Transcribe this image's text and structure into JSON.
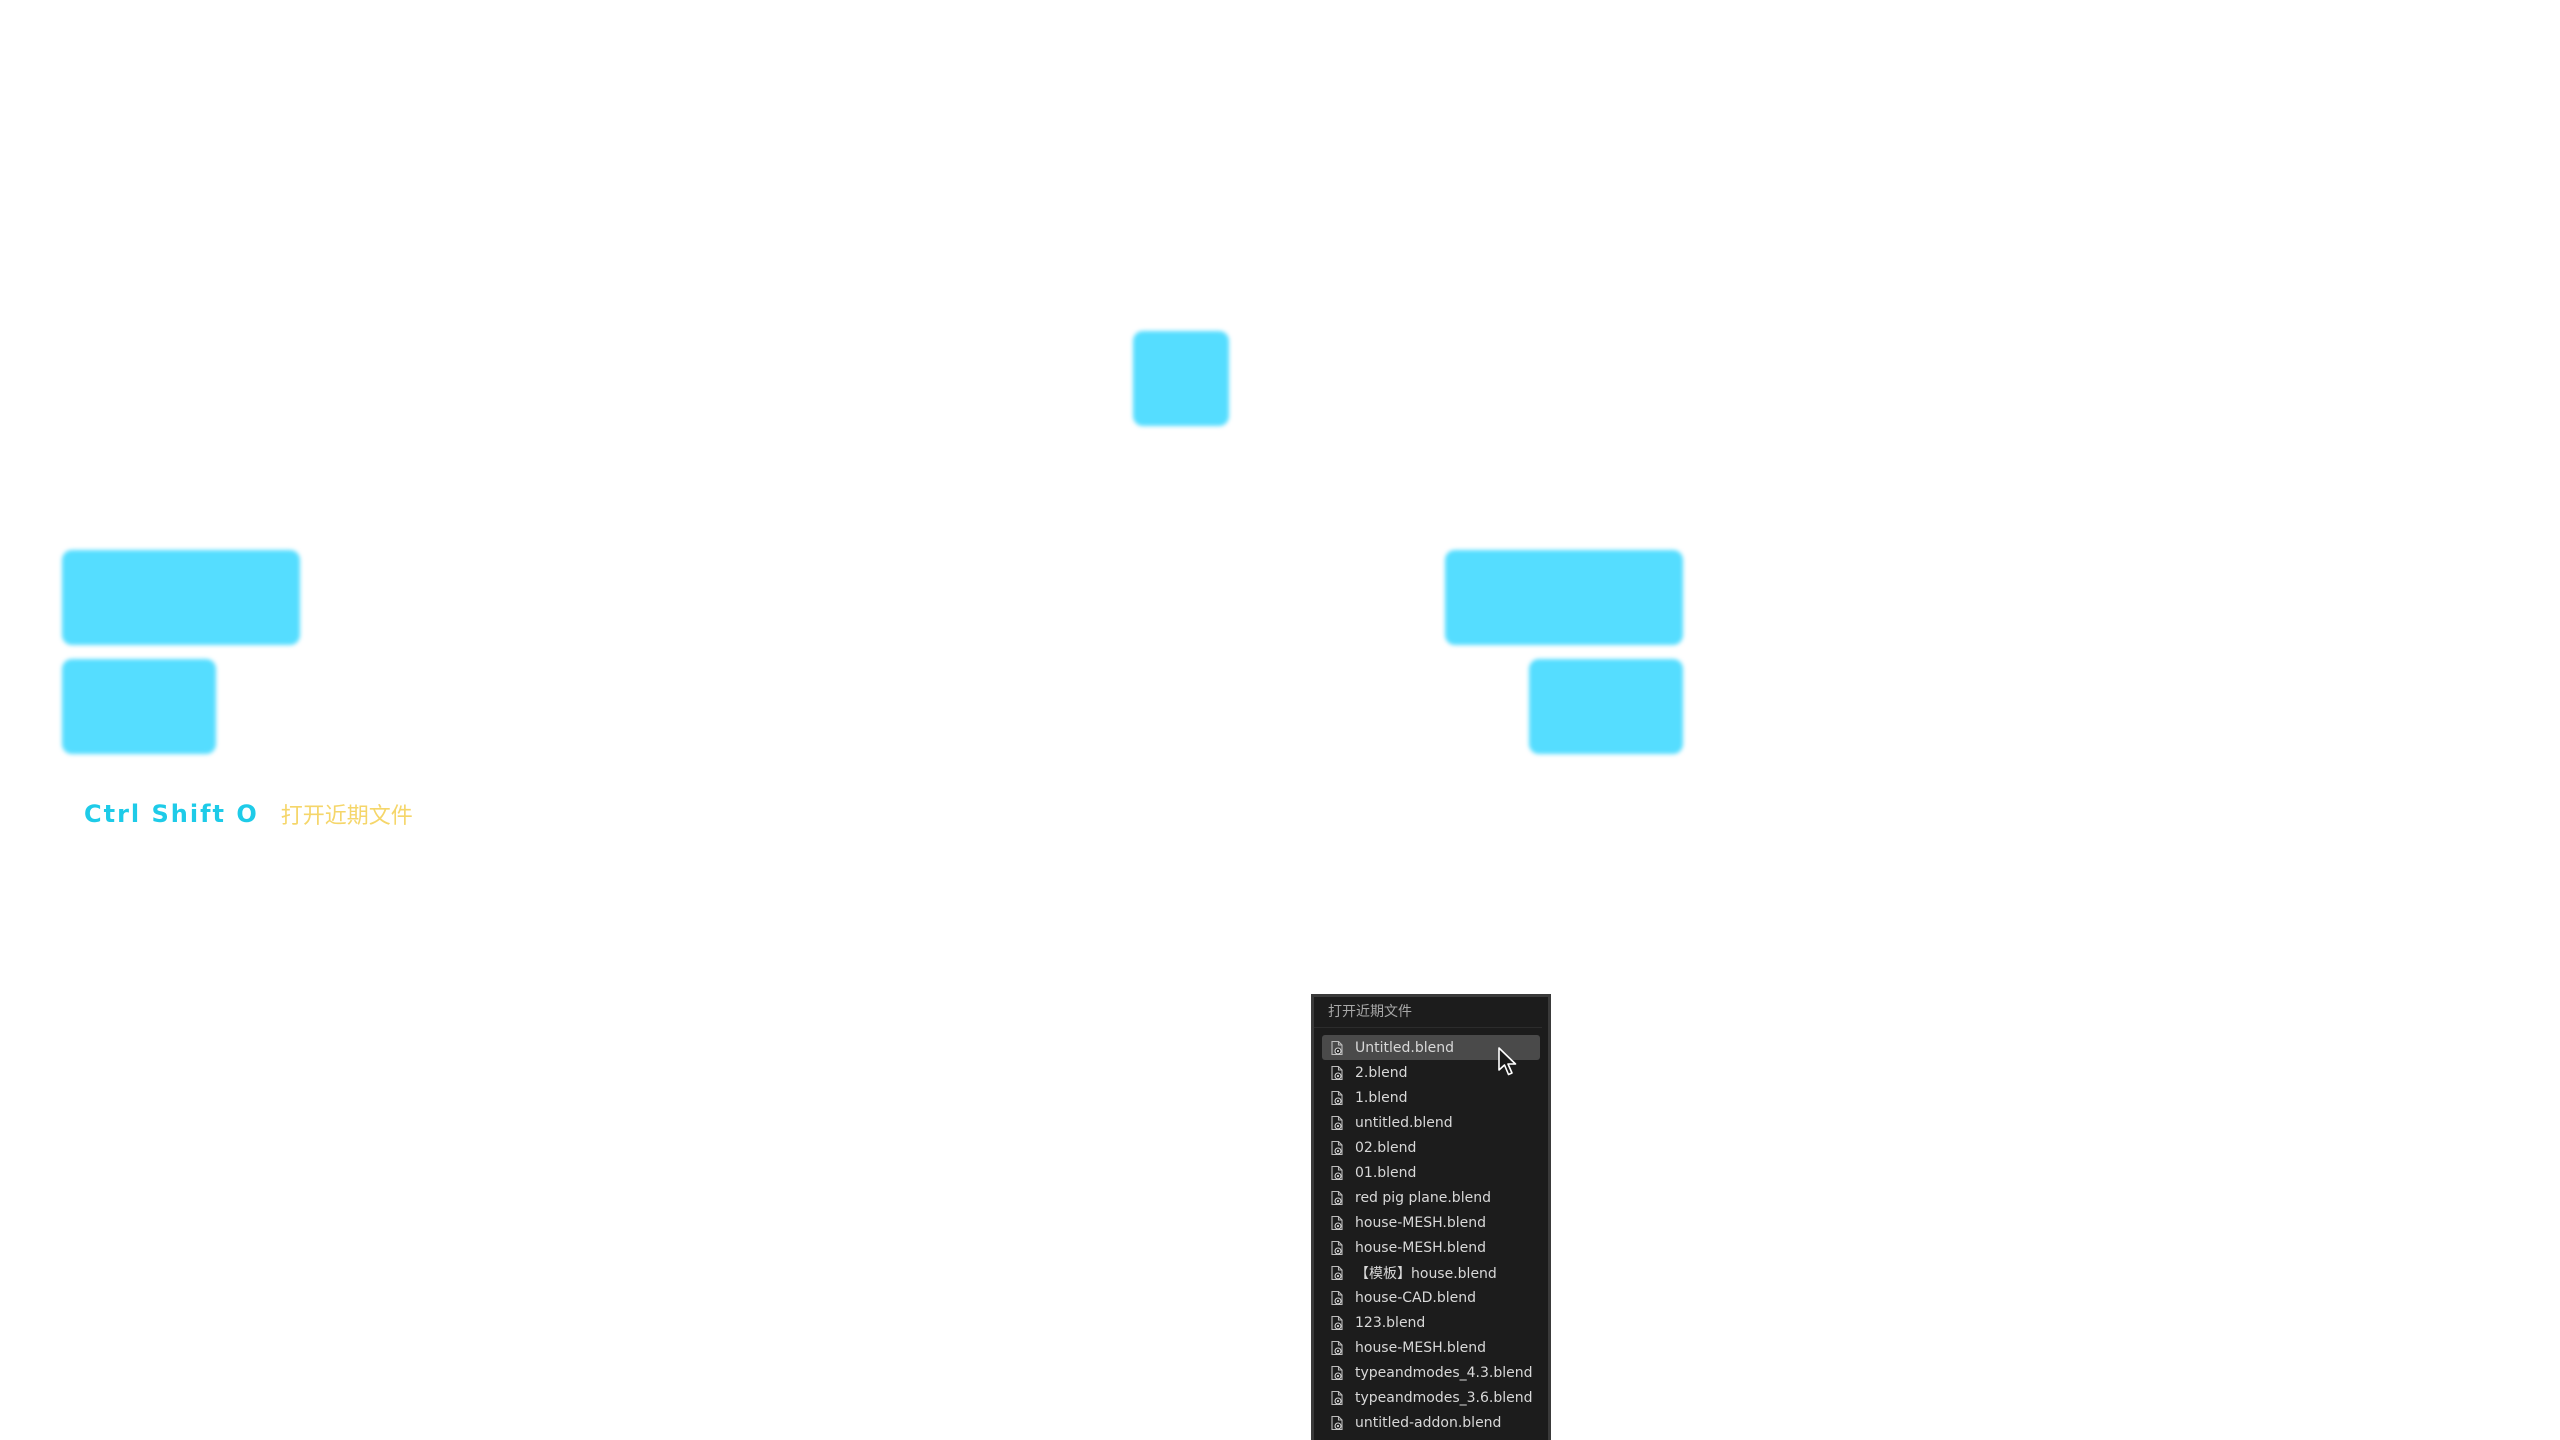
{
  "shortcut": {
    "keys": "Ctrl Shift O",
    "description": "打开近期文件"
  },
  "colors": {
    "blob": "#55ddff",
    "shortcut_keys": "#1ecbe8",
    "shortcut_desc": "#f5d66a",
    "menu_bg": "#1c1c1c",
    "menu_highlight": "#4a4a4a"
  },
  "menu": {
    "title": "打开近期文件",
    "item_icon": "blend-file-icon",
    "items": [
      {
        "label": "Untitled.blend",
        "active": true
      },
      {
        "label": "2.blend"
      },
      {
        "label": "1.blend"
      },
      {
        "label": "untitled.blend"
      },
      {
        "label": "02.blend"
      },
      {
        "label": "01.blend"
      },
      {
        "label": "red pig plane.blend"
      },
      {
        "label": "house-MESH.blend"
      },
      {
        "label": "house-MESH.blend"
      },
      {
        "label": "【模板】house.blend"
      },
      {
        "label": "house-CAD.blend"
      },
      {
        "label": "123.blend"
      },
      {
        "label": "house-MESH.blend"
      },
      {
        "label": "typeandmodes_4.3.blend"
      },
      {
        "label": "typeandmodes_3.6.blend"
      },
      {
        "label": "untitled-addon.blend"
      },
      {
        "label": ""
      }
    ]
  },
  "cursor_icon": "mouse-pointer-icon"
}
